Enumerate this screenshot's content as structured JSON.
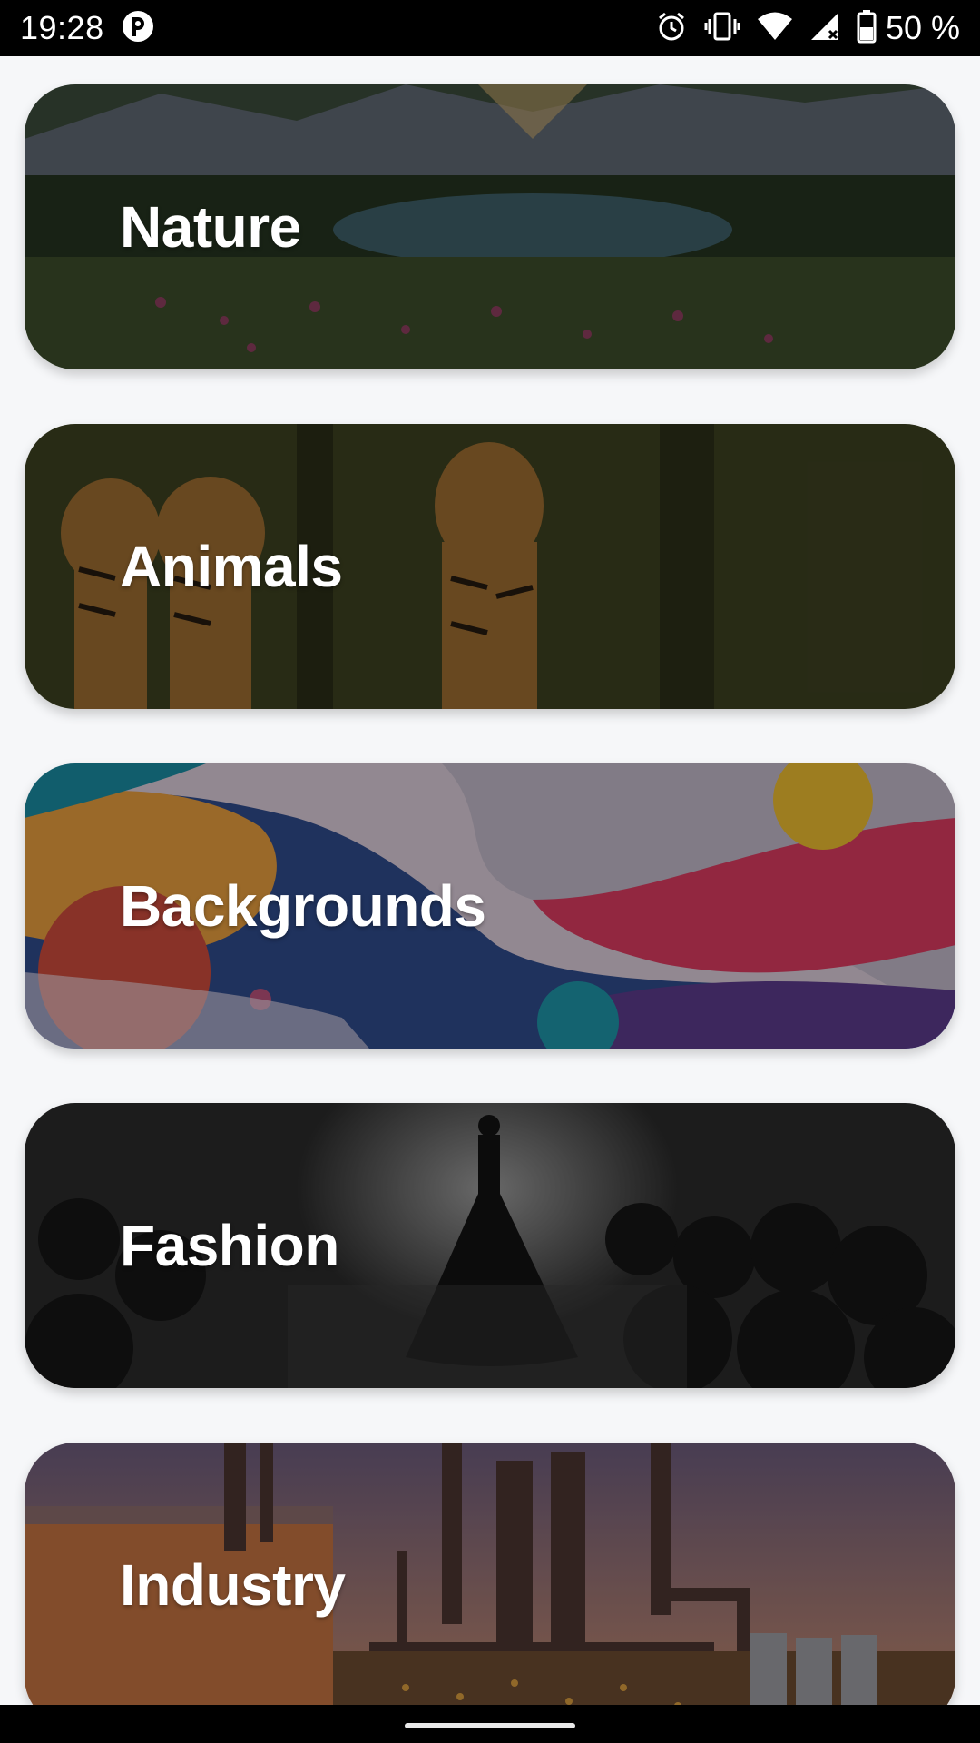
{
  "status_bar": {
    "time": "19:28",
    "battery_percent": "50 %",
    "icons": [
      "app-notification-icon",
      "alarm-icon",
      "vibrate-icon",
      "wifi-icon",
      "cell-signal-icon",
      "battery-icon"
    ]
  },
  "categories": [
    {
      "label": "Nature"
    },
    {
      "label": "Animals"
    },
    {
      "label": "Backgrounds"
    },
    {
      "label": "Fashion"
    },
    {
      "label": "Industry"
    }
  ],
  "colors": {
    "page_background": "#f6f7f9",
    "status_bar": "#000000",
    "label_text": "#ffffff"
  }
}
